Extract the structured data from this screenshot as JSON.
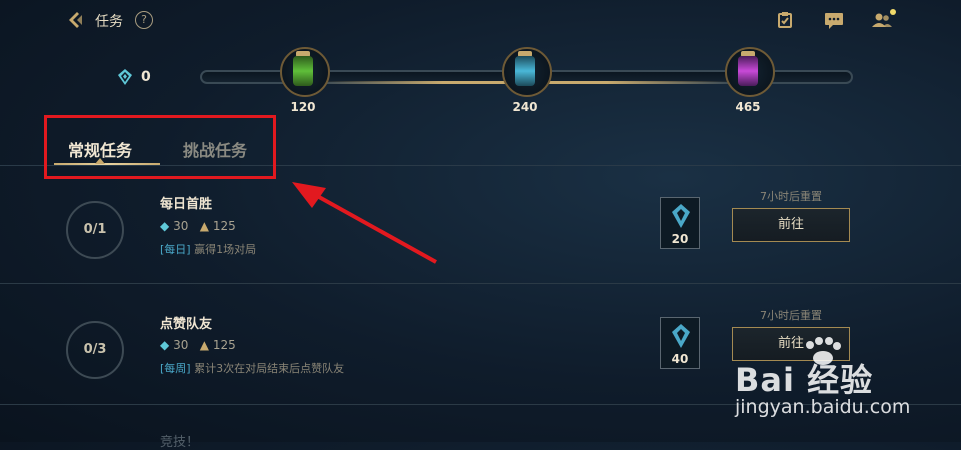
{
  "header": {
    "title": "任务",
    "help_glyph": "?",
    "icons": [
      "back-chevron-icon",
      "clipboard-icon",
      "chat-icon",
      "friends-icon"
    ]
  },
  "progress": {
    "currency_value": "0",
    "milestones": [
      {
        "value": "120",
        "color": "#5fbf3a"
      },
      {
        "value": "240",
        "color": "#4ab8d8"
      },
      {
        "value": "465",
        "color": "#c84ad8"
      }
    ]
  },
  "tabs": [
    {
      "label": "常规任务",
      "active": true
    },
    {
      "label": "挑战任务",
      "active": false
    }
  ],
  "missions": [
    {
      "progress": "0/1",
      "title": "每日首胜",
      "reward_blue": "30",
      "reward_gold": "125",
      "tag": "[每日]",
      "description": "赢得1场对局",
      "reward_points": "20",
      "reset_text": "7小时后重置",
      "button_label": "前往"
    },
    {
      "progress": "0/3",
      "title": "点赞队友",
      "reward_blue": "30",
      "reward_gold": "125",
      "tag": "[每周]",
      "description": "累计3次在对局结束后点赞队友",
      "reward_points": "40",
      "reset_text": "7小时后重置",
      "button_label": "前往"
    }
  ],
  "next_row_partial": "竞技！",
  "colors": {
    "accent_gold": "#c8aa6e",
    "highlight_red": "#e2191f",
    "blue_currency": "#5fc8d8"
  },
  "watermark": {
    "brand": "Bai 经验",
    "url": "jingyan.baidu.com"
  }
}
